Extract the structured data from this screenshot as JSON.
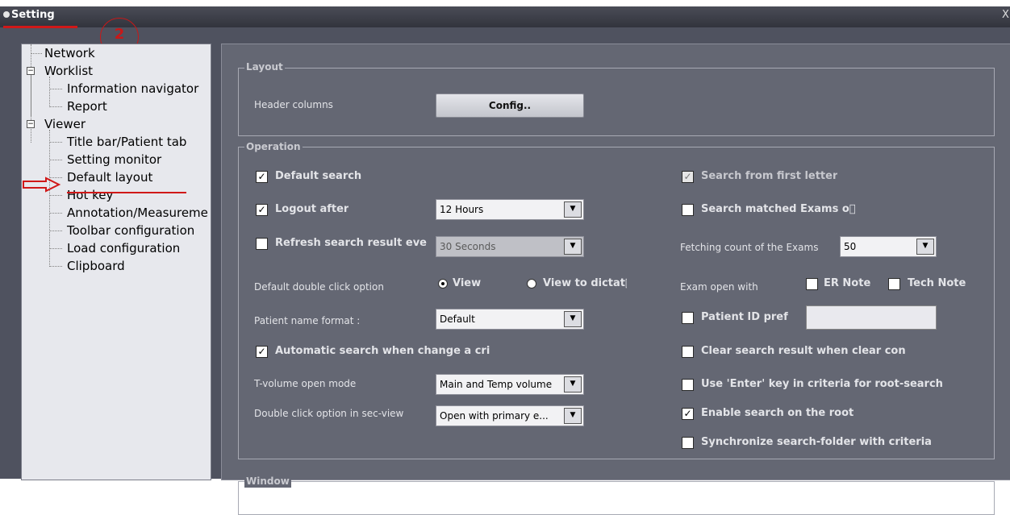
{
  "window": {
    "title": "Setting",
    "close_glyph": "X"
  },
  "annotation": {
    "step": "2"
  },
  "tree": {
    "network": "Network",
    "worklist": "Worklist",
    "information_navigator": "Information navigator",
    "report": "Report",
    "viewer": "Viewer",
    "title_bar": "Title bar/Patient tab",
    "setting_monitor": "Setting monitor",
    "default_layout": "Default layout",
    "hot_key": "Hot key",
    "annotation": "Annotation/Measureme",
    "toolbar": "Toolbar configuration",
    "load_config": "Load configuration",
    "clipboard": "Clipboard",
    "expander_glyph": "−"
  },
  "layout": {
    "legend": "Layout",
    "header_columns_label": "Header columns",
    "config_button": "Config.."
  },
  "operation": {
    "legend": "Operation",
    "default_search": {
      "label": "Default search",
      "checked": true
    },
    "logout_after": {
      "label": "Logout after",
      "checked": true,
      "value": "12 Hours"
    },
    "refresh_search": {
      "label": "Refresh search result eve",
      "checked": false,
      "value": "30 Seconds"
    },
    "default_double_click_label": "Default double click option",
    "radio_view": "View",
    "radio_view_to_dictate": "View to dictat\u0000",
    "patient_name_format_label": "Patient name format :",
    "patient_name_format_value": "Default",
    "automatic_search": {
      "label": "Automatic search when change a cri",
      "checked": true
    },
    "tvolume_label": "T-volume open mode",
    "tvolume_value": "Main and Temp volume",
    "double_click_secview_label": "Double click option in sec-view",
    "double_click_secview_value": "Open with primary e...",
    "search_first_letter": {
      "label": "Search from first letter",
      "checked": true
    },
    "search_matched": {
      "label": "Search matched Exams o\u0000",
      "checked": false
    },
    "fetching_count_label": "Fetching count of the Exams",
    "fetching_count_value": "50",
    "exam_open_with_label": "Exam open with",
    "er_note": "ER Note",
    "tech_note": "Tech Note",
    "patient_id_pref": {
      "label": "Patient ID pref",
      "checked": false
    },
    "clear_search_result": {
      "label": "Clear search result when clear con",
      "checked": false
    },
    "use_enter_key": {
      "label": "Use 'Enter' key in criteria for root-search",
      "checked": false
    },
    "enable_search_root": {
      "label": "Enable search on the root",
      "checked": true
    },
    "synchronize_search": {
      "label": "Synchronize search-folder with criteria",
      "checked": false
    }
  },
  "window_group": {
    "legend": "Window"
  },
  "glyphs": {
    "check": "✓",
    "dropdown": "▼"
  },
  "colors": {
    "annotation_red": "#d01818",
    "panel_bg": "#646773",
    "tree_bg": "#e7e8ed"
  }
}
